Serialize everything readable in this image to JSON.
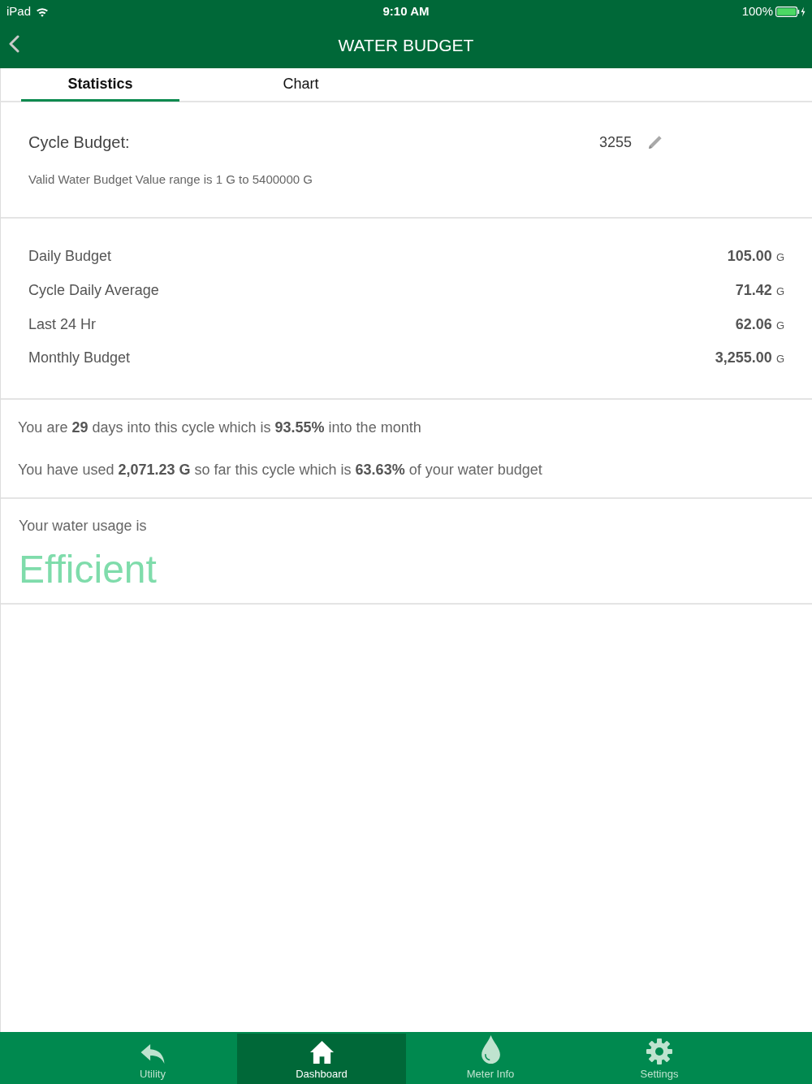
{
  "status_bar": {
    "carrier": "iPad",
    "time": "9:10 AM",
    "battery": "100%"
  },
  "nav_bar": {
    "title": "WATER BUDGET"
  },
  "tabs": [
    {
      "label": "Statistics",
      "selected": true
    },
    {
      "label": "Chart",
      "selected": false
    }
  ],
  "cycle_budget": {
    "label": "Cycle Budget:",
    "value": "3255",
    "hint": "Valid Water Budget Value range is 1 G to 5400000 G"
  },
  "stats": [
    {
      "label": "Daily Budget",
      "value": "105.00",
      "unit": "G"
    },
    {
      "label": "Cycle Daily Average",
      "value": "71.42",
      "unit": "G"
    },
    {
      "label": "Last 24 Hr",
      "value": "62.06",
      "unit": "G"
    },
    {
      "label": "Monthly Budget",
      "value": "3,255.00",
      "unit": "G"
    }
  ],
  "summary": [
    "You are **29** days into this cycle which is **93.55%** into the month",
    "You have used **2,071.23 G** so far this cycle which is **63.63%** of your water budget"
  ],
  "usage": {
    "label": "Your water usage is",
    "rating": "Efficient"
  },
  "tab_bar": [
    {
      "label": "Utility",
      "kind": "back",
      "selected": false
    },
    {
      "label": "Dashboard",
      "kind": "home",
      "selected": true
    },
    {
      "label": "Meter Info",
      "kind": "drop",
      "selected": false
    },
    {
      "label": "Settings",
      "kind": "gear",
      "selected": false
    }
  ]
}
